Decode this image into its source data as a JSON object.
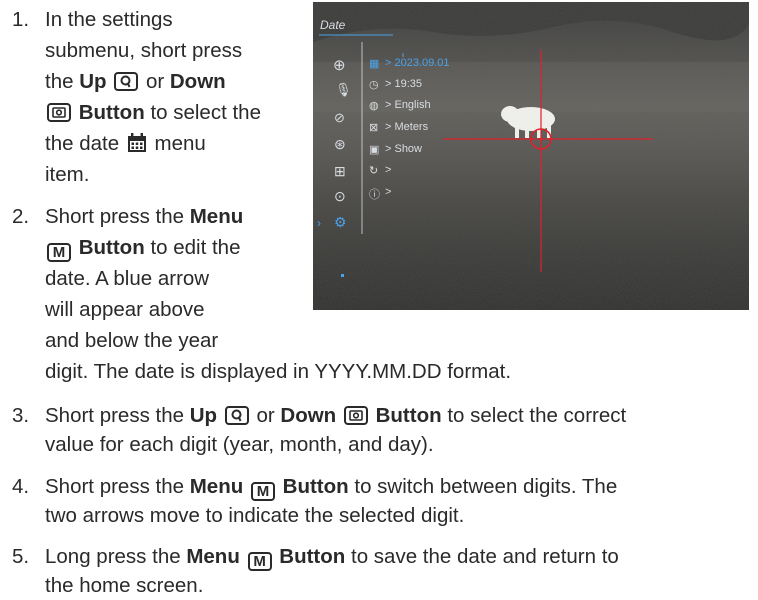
{
  "steps": [
    {
      "num": "1.",
      "lines": [
        "In the settings",
        "submenu, short press"
      ]
    },
    {
      "num": "2.",
      "lines": [
        "Short press the",
        "Button to edit the",
        "date. A blue arrow",
        "will appear above",
        "and below the year",
        "digit. The date is displayed in YYYY.MM.DD format."
      ]
    },
    {
      "num": "3.",
      "lines": [
        "value for each digit (year, month, and day)."
      ]
    },
    {
      "num": "4.",
      "lines": [
        "two arrows move to indicate the selected digit."
      ]
    },
    {
      "num": "5.",
      "lines": [
        "the home screen."
      ]
    }
  ],
  "text": {
    "the": "the",
    "up": "Up",
    "or": "or",
    "down": "Down",
    "button": "Button",
    "to_select_the": "to select the",
    "the_date": "the date",
    "menu": "menu",
    "item": "item.",
    "menu_bold": "Menu",
    "s3_start": "Short press the",
    "s3_mid": "Button to select the correct",
    "s4_start": "Short press the",
    "s4_mid": "Button to switch between digits. The",
    "s5_start": "Long press the",
    "s5_mid": "Button to save the date and return to",
    "key_m": "M"
  },
  "screen": {
    "title": "Date",
    "items": [
      {
        "icon": "calendar-icon",
        "value": "> 2023.09.01",
        "selected": true
      },
      {
        "icon": "clock-icon",
        "value": "> 19:35"
      },
      {
        "icon": "globe-icon",
        "value": "> English"
      },
      {
        "icon": "ruler-icon",
        "value": "> Meters"
      },
      {
        "icon": "display-icon",
        "value": "> Show"
      },
      {
        "icon": "reset-icon",
        "value": ">"
      },
      {
        "icon": "info-icon",
        "value": ">"
      }
    ],
    "sidebar_icons": [
      "crosshair-icon",
      "microphone-icon",
      "screen-off-icon",
      "settings-star-icon",
      "frame-plus-icon",
      "compass-icon",
      "gear-icon"
    ],
    "colors": {
      "accent": "#4aa3e8",
      "reticle": "#e0202a"
    }
  }
}
